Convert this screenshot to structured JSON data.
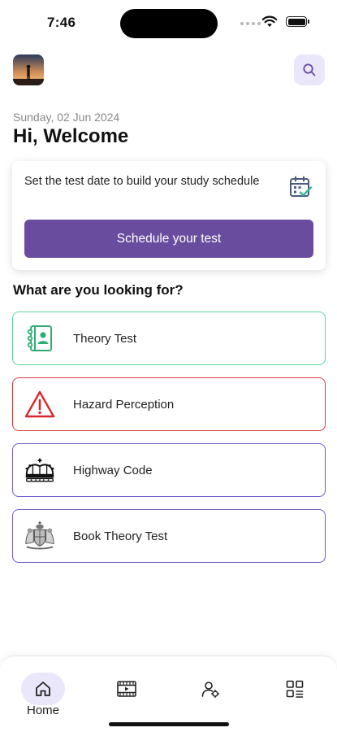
{
  "status_bar": {
    "time": "7:46"
  },
  "header": {
    "avatar_icon": "profile-photo",
    "search_icon": "search-icon"
  },
  "greeting": {
    "date": "Sunday, 02 Jun 2024",
    "title": "Hi, Welcome"
  },
  "schedule_card": {
    "text": "Set the test date to build your study schedule",
    "icon": "calendar-check-icon",
    "button_label": "Schedule your test"
  },
  "section": {
    "title": "What are you looking for?"
  },
  "options": [
    {
      "label": "Theory Test",
      "icon": "contact-book-icon",
      "border_color": "#5fd39a"
    },
    {
      "label": "Hazard Perception",
      "icon": "warning-triangle-icon",
      "border_color": "#e0393e"
    },
    {
      "label": "Highway Code",
      "icon": "crown-icon",
      "border_color": "#6d5bd0"
    },
    {
      "label": "Book Theory Test",
      "icon": "royal-coat-of-arms-icon",
      "border_color": "#6d5bd0"
    }
  ],
  "bottom_nav": {
    "items": [
      {
        "label": "Home",
        "icon": "home-icon",
        "active": true
      },
      {
        "label": "",
        "icon": "video-film-icon",
        "active": false
      },
      {
        "label": "",
        "icon": "user-settings-icon",
        "active": false
      },
      {
        "label": "",
        "icon": "grid-menu-icon",
        "active": false
      }
    ]
  },
  "colors": {
    "accent": "#6a4c9e",
    "accent_light": "#ebe7fb",
    "muted_text": "#888888"
  }
}
